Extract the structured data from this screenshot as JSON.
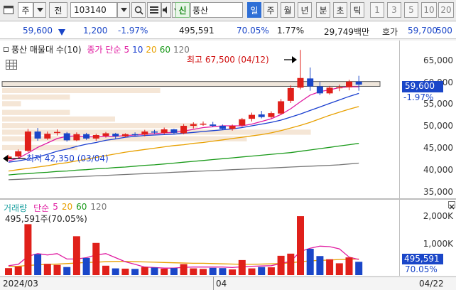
{
  "toolbar": {
    "window_icon": "window-icon",
    "market_label": "주",
    "prev_label": "전",
    "code_value": "103140",
    "search_icon": "search-icon",
    "menu_icon": "menu-icon",
    "sound_icon": "speaker-icon",
    "credit_badge": "신",
    "stock_name": "풍산",
    "period_buttons": [
      {
        "label": "일",
        "selected": true
      },
      {
        "label": "주",
        "selected": false
      },
      {
        "label": "월",
        "selected": false
      },
      {
        "label": "년",
        "selected": false
      },
      {
        "label": "분",
        "selected": false
      },
      {
        "label": "초",
        "selected": false
      },
      {
        "label": "틱",
        "selected": false
      }
    ],
    "interval_buttons": [
      "1",
      "3",
      "5",
      "10",
      "20"
    ]
  },
  "quote": {
    "price": "59,600",
    "direction_icon": "down-triangle-icon",
    "change": "1,200",
    "change_pct": "-1.97%",
    "volume": "495,591",
    "vol_ratio": "70.05%",
    "turnover_pct": "1.77%",
    "amount": "29,749백만",
    "ask_label": "호가",
    "ask_price": "59,700",
    "last": "500"
  },
  "price_panel": {
    "legend_name": "풍산 매물대 수(10)",
    "ma_label": "종가 단순",
    "ma_periods": [
      "5",
      "10",
      "20",
      "60",
      "120"
    ],
    "ma_colors": [
      "#e01aa0",
      "#1a3fd0",
      "#e8a000",
      "#1a9a1a",
      "#777777"
    ],
    "high_annotation": "최고 67,500 (04/12)",
    "low_annotation": "최저 42,350 (03/04)",
    "price_tag": "59,600",
    "pct_tag": "-1.97%",
    "table_icon": "grid-icon"
  },
  "volume_panel": {
    "title": "거래량",
    "ma_label": "단순",
    "ma_periods": [
      "5",
      "20",
      "60",
      "120"
    ],
    "summary": "495,591주(70.05%)",
    "volume_tag": "495,591",
    "pct_tag": "70.05%",
    "close_icon": "close-icon"
  },
  "axis": {
    "price_ticks": [
      "65,000",
      "60,000",
      "55,000",
      "50,000",
      "45,000",
      "40,000",
      "35,000"
    ],
    "volume_ticks": [
      "2,000K",
      "1,000K"
    ],
    "date_left": "2024/03",
    "date_mid": "04",
    "date_right": "04/22"
  },
  "chart_data": {
    "type": "candlestick",
    "price_range": [
      34000,
      69000
    ],
    "volume_range": [
      0,
      2600000
    ],
    "candles": [
      {
        "o": 42600,
        "h": 43600,
        "l": 42350,
        "c": 43200,
        "v": 260000
      },
      {
        "o": 43200,
        "h": 44800,
        "l": 42700,
        "c": 44400,
        "v": 320000
      },
      {
        "o": 44500,
        "h": 49500,
        "l": 44200,
        "c": 48900,
        "v": 1900000
      },
      {
        "o": 48900,
        "h": 49700,
        "l": 46800,
        "c": 47300,
        "v": 780000
      },
      {
        "o": 47300,
        "h": 48900,
        "l": 47000,
        "c": 48400,
        "v": 420000
      },
      {
        "o": 48600,
        "h": 49400,
        "l": 48000,
        "c": 48800,
        "v": 380000
      },
      {
        "o": 48500,
        "h": 48800,
        "l": 46600,
        "c": 46900,
        "v": 300000
      },
      {
        "o": 46900,
        "h": 48700,
        "l": 46700,
        "c": 48300,
        "v": 1450000
      },
      {
        "o": 48300,
        "h": 48600,
        "l": 47000,
        "c": 47300,
        "v": 640000
      },
      {
        "o": 47300,
        "h": 48400,
        "l": 46800,
        "c": 48100,
        "v": 1200000
      },
      {
        "o": 47900,
        "h": 48800,
        "l": 47500,
        "c": 48500,
        "v": 350000
      },
      {
        "o": 48400,
        "h": 48600,
        "l": 47300,
        "c": 47800,
        "v": 250000
      },
      {
        "o": 47800,
        "h": 48500,
        "l": 47600,
        "c": 48300,
        "v": 240000
      },
      {
        "o": 48300,
        "h": 48700,
        "l": 47900,
        "c": 48100,
        "v": 230000
      },
      {
        "o": 48200,
        "h": 49300,
        "l": 47800,
        "c": 48900,
        "v": 300000
      },
      {
        "o": 48900,
        "h": 49300,
        "l": 48400,
        "c": 48700,
        "v": 280000
      },
      {
        "o": 48600,
        "h": 49800,
        "l": 48300,
        "c": 49400,
        "v": 240000
      },
      {
        "o": 49400,
        "h": 49500,
        "l": 48400,
        "c": 48600,
        "v": 260000
      },
      {
        "o": 48500,
        "h": 50600,
        "l": 48300,
        "c": 50200,
        "v": 410000
      },
      {
        "o": 50200,
        "h": 51000,
        "l": 49600,
        "c": 50600,
        "v": 250000
      },
      {
        "o": 50600,
        "h": 51200,
        "l": 50200,
        "c": 50700,
        "v": 230000
      },
      {
        "o": 50500,
        "h": 51100,
        "l": 49900,
        "c": 50200,
        "v": 270000
      },
      {
        "o": 50200,
        "h": 50500,
        "l": 49300,
        "c": 49500,
        "v": 260000
      },
      {
        "o": 49500,
        "h": 50500,
        "l": 49100,
        "c": 50200,
        "v": 210000
      },
      {
        "o": 50300,
        "h": 52000,
        "l": 50000,
        "c": 51700,
        "v": 560000
      },
      {
        "o": 51800,
        "h": 53200,
        "l": 51200,
        "c": 52700,
        "v": 250000
      },
      {
        "o": 52800,
        "h": 53600,
        "l": 51900,
        "c": 52200,
        "v": 300000
      },
      {
        "o": 52200,
        "h": 53500,
        "l": 51900,
        "c": 53100,
        "v": 290000
      },
      {
        "o": 53000,
        "h": 56300,
        "l": 52700,
        "c": 55800,
        "v": 720000
      },
      {
        "o": 55900,
        "h": 59400,
        "l": 55400,
        "c": 58800,
        "v": 800000
      },
      {
        "o": 58900,
        "h": 67500,
        "l": 58500,
        "c": 61100,
        "v": 2200000
      },
      {
        "o": 61000,
        "h": 63500,
        "l": 58200,
        "c": 59200,
        "v": 980000
      },
      {
        "o": 59200,
        "h": 60200,
        "l": 57200,
        "c": 57600,
        "v": 710000
      },
      {
        "o": 57600,
        "h": 59300,
        "l": 57300,
        "c": 58900,
        "v": 590000
      },
      {
        "o": 58900,
        "h": 59600,
        "l": 58100,
        "c": 59000,
        "v": 440000
      },
      {
        "o": 59000,
        "h": 60700,
        "l": 58300,
        "c": 60300,
        "v": 660000
      },
      {
        "o": 60300,
        "h": 61600,
        "l": 58200,
        "c": 59600,
        "v": 495591
      }
    ],
    "ma5": [
      42200,
      42800,
      44000,
      45300,
      46300,
      47300,
      47800,
      47900,
      47700,
      47700,
      47800,
      47800,
      48000,
      48100,
      48300,
      48400,
      48600,
      48700,
      49000,
      49400,
      49800,
      50000,
      50200,
      50200,
      50200,
      50600,
      51200,
      51800,
      52800,
      54100,
      55700,
      57200,
      58000,
      58400,
      58900,
      59100,
      59100
    ],
    "ma10": [
      41900,
      42200,
      42600,
      43100,
      43700,
      44400,
      44900,
      45500,
      46000,
      46400,
      46900,
      47200,
      47600,
      47800,
      48000,
      48100,
      48200,
      48300,
      48500,
      48700,
      48900,
      49100,
      49300,
      49500,
      49800,
      50200,
      50600,
      51000,
      51500,
      52200,
      52900,
      53700,
      54500,
      55300,
      56100,
      56900,
      57600
    ],
    "ma20": [
      39900,
      40200,
      40500,
      40800,
      41100,
      41500,
      41800,
      42200,
      42600,
      43000,
      43400,
      43800,
      44200,
      44500,
      44800,
      45100,
      45400,
      45700,
      45900,
      46200,
      46400,
      46700,
      47000,
      47300,
      47600,
      47900,
      48200,
      48600,
      49100,
      49700,
      50300,
      51000,
      51800,
      52600,
      53300,
      54000,
      54600
    ],
    "ma60": [
      39000,
      39200,
      39300,
      39500,
      39600,
      39800,
      39900,
      40100,
      40200,
      40400,
      40500,
      40700,
      40800,
      41000,
      41200,
      41300,
      41500,
      41700,
      41900,
      42100,
      42300,
      42500,
      42700,
      42900,
      43100,
      43300,
      43500,
      43700,
      43900,
      44100,
      44400,
      44700,
      45000,
      45300,
      45600,
      45900,
      46200
    ],
    "ma120": [
      37900,
      38000,
      38100,
      38200,
      38300,
      38400,
      38500,
      38600,
      38700,
      38800,
      38900,
      39000,
      39100,
      39200,
      39300,
      39400,
      39500,
      39600,
      39700,
      39800,
      39900,
      40000,
      40100,
      40200,
      40300,
      40400,
      40500,
      40600,
      40700,
      40800,
      40900,
      41000,
      41100,
      41200,
      41300,
      41500,
      41700
    ],
    "vol_ma5": [
      350000,
      400000,
      700000,
      800000,
      750000,
      800000,
      600000,
      600000,
      650000,
      750000,
      800000,
      650000,
      500000,
      400000,
      300000,
      280000,
      260000,
      260000,
      290000,
      300000,
      300000,
      300000,
      300000,
      280000,
      310000,
      330000,
      340000,
      350000,
      430000,
      520000,
      880000,
      1000000,
      1080000,
      1060000,
      980000,
      670000,
      580000
    ],
    "vol_ma20": [
      320000,
      330000,
      360000,
      380000,
      400000,
      410000,
      430000,
      450000,
      470000,
      480000,
      500000,
      510000,
      510000,
      500000,
      490000,
      480000,
      470000,
      460000,
      450000,
      440000,
      440000,
      430000,
      420000,
      410000,
      400000,
      400000,
      410000,
      420000,
      430000,
      460000,
      500000,
      530000,
      550000,
      560000,
      580000,
      590000,
      600000
    ],
    "volume_profile": [
      {
        "low": 59000,
        "high": 60500,
        "weight": 0.86
      },
      {
        "low": 57500,
        "high": 59000,
        "weight": 0.42
      },
      {
        "low": 56000,
        "high": 57500,
        "weight": 0.18
      },
      {
        "low": 54500,
        "high": 56000,
        "weight": 0.05
      },
      {
        "low": 52500,
        "high": 54000,
        "weight": 0.18
      },
      {
        "low": 51000,
        "high": 52500,
        "weight": 0.3
      },
      {
        "low": 49500,
        "high": 51000,
        "weight": 0.52
      },
      {
        "low": 48000,
        "high": 49500,
        "weight": 0.82
      },
      {
        "low": 46500,
        "high": 48000,
        "weight": 0.65
      },
      {
        "low": 44500,
        "high": 46000,
        "weight": 0.2
      }
    ],
    "legend_placement": "top-left",
    "grid": false
  }
}
